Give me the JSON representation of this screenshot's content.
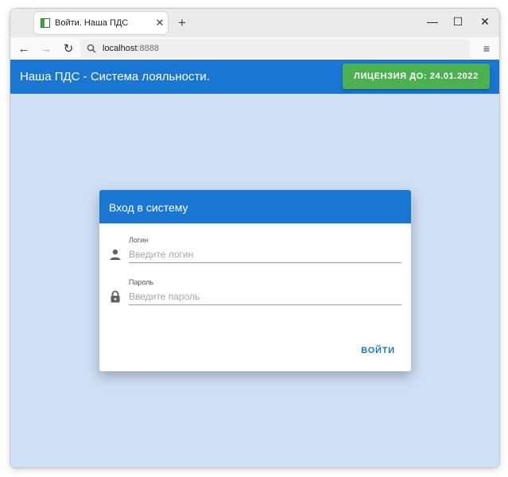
{
  "browser": {
    "tab_title": "Войти. Наша ПДС",
    "tab_close": "✕",
    "new_tab": "+",
    "url_host": "localhost",
    "url_port": ":8888",
    "minimize": "—",
    "maximize": "☐",
    "close": "✕",
    "back": "←",
    "forward": "→",
    "reload": "↻",
    "menu": "≡"
  },
  "app": {
    "title": "Наша ПДС - Система лояльности.",
    "license_label": "ЛИЦЕНЗИЯ ДО: 24.01.2022"
  },
  "login_card": {
    "title": "Вход в систему",
    "login_label": "Логин",
    "login_placeholder": "Введите логин",
    "password_label": "Пароль",
    "password_placeholder": "Введите пароль",
    "submit_label": "ВОЙТИ"
  },
  "colors": {
    "primary": "#1976d2",
    "license_green": "#4caf50",
    "page_background": "#cfdff5"
  },
  "icons": {
    "login_field": "person-icon",
    "password_field": "lock-icon",
    "tab_favicon": "sidebar-page-icon",
    "address_bar": "search-icon"
  }
}
